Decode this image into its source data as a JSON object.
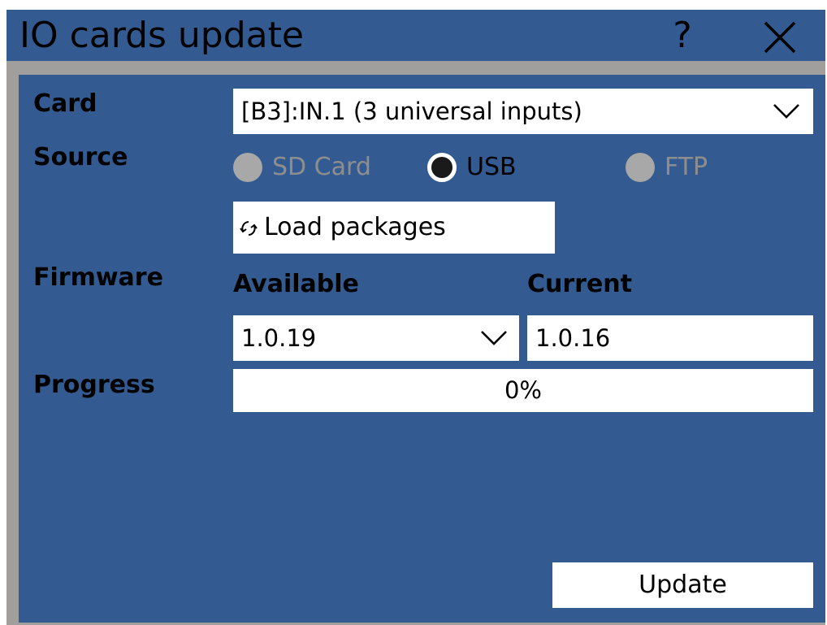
{
  "window": {
    "title": "IO cards update",
    "help_label": "?",
    "close_icon": "close-icon"
  },
  "form": {
    "card_label": "Card",
    "card_value": "[B3]:IN.1 (3 universal inputs)",
    "source_label": "Source",
    "source_options": [
      {
        "label": "SD Card",
        "enabled": false,
        "selected": false
      },
      {
        "label": "USB",
        "enabled": true,
        "selected": true
      },
      {
        "label": "FTP",
        "enabled": false,
        "selected": false
      }
    ],
    "load_button_label": "Load packages",
    "load_icon": "refresh-icon",
    "firmware_label": "Firmware",
    "available_heading": "Available",
    "current_heading": "Current",
    "available_value": "1.0.19",
    "current_value": "1.0.16",
    "progress_label": "Progress",
    "progress_text": "0%",
    "progress_fraction": 0,
    "update_button_label": "Update"
  },
  "colors": {
    "panel_bg": "#335b91",
    "frame_gray": "#a09f9e",
    "field_bg": "#ffffff",
    "disabled_radio": "#a8a8a8",
    "disabled_text": "#8e8e8e"
  }
}
